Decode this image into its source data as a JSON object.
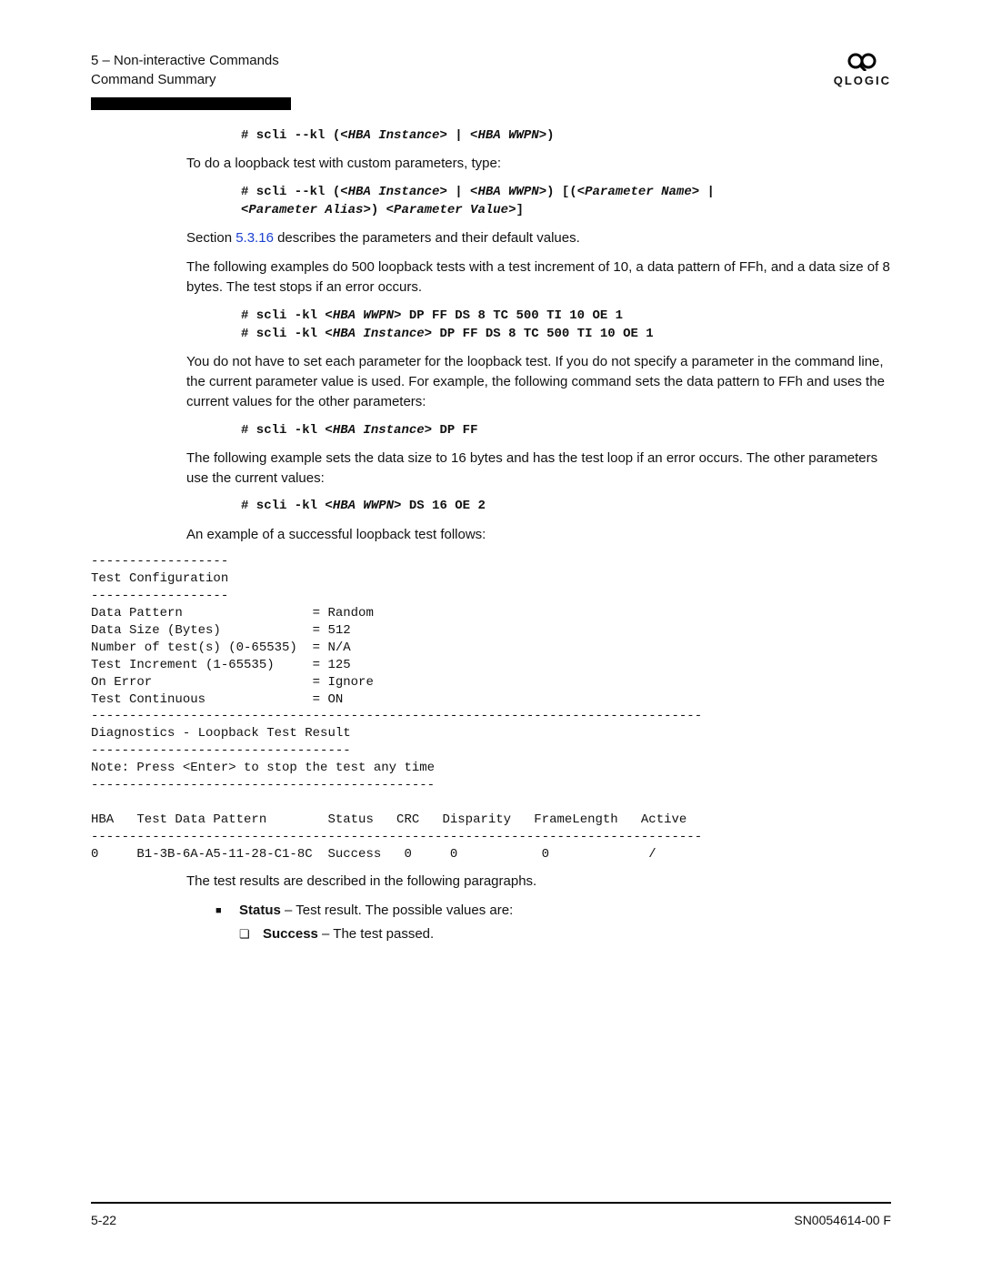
{
  "header": {
    "chapter": "5 – Non-interactive Commands",
    "section": "Command Summary",
    "brand": "QLOGIC"
  },
  "cmd1": {
    "pre": "# scli --kl (<",
    "v1": "HBA Instance",
    "mid": "> | <",
    "v2": "HBA WWPN",
    "post": ">)"
  },
  "p1": "To do a loopback test with custom parameters, type:",
  "cmd2": {
    "l1pre": "# scli --kl (<",
    "l1v1": "HBA Instance",
    "l1mid": "> | <",
    "l1v2": "HBA WWPN",
    "l1mid2": ">) [(<",
    "l1v3": "Parameter Name",
    "l1post": "> |",
    "l2pre": "<",
    "l2v1": "Parameter Alias",
    "l2mid": ">) <",
    "l2v2": "Parameter Value",
    "l2post": ">]"
  },
  "p2": {
    "a": "Section ",
    "link": "5.3.16",
    "b": " describes the parameters and their default values."
  },
  "p3": "The following examples do 500 loopback tests with a test increment of 10, a data pattern of FFh, and a data size of 8 bytes. The test stops if an error occurs.",
  "cmd3": {
    "l1pre": "# scli -kl <",
    "l1v": "HBA WWPN",
    "l1post": "> DP FF DS 8 TC 500 TI 10 OE 1",
    "l2pre": "# scli -kl <",
    "l2v": "HBA Instance",
    "l2post": "> DP FF DS 8 TC 500 TI 10 OE 1"
  },
  "p4": "You do not have to set each parameter for the loopback test. If you do not specify a parameter in the command line, the current parameter value is used. For example, the following command sets the data pattern to FFh and uses the current values for the other parameters:",
  "cmd4": {
    "pre": "# scli -kl <",
    "v": "HBA Instance",
    "post": "> DP FF"
  },
  "p5": "The following example sets the data size to 16 bytes and has the test loop if an error occurs. The other parameters use the current values:",
  "cmd5": {
    "pre": "# scli -kl <",
    "v": "HBA WWPN",
    "post": "> DS 16 OE 2"
  },
  "p6": "An example of a successful loopback test follows:",
  "output": "------------------\nTest Configuration\n------------------\nData Pattern                 = Random\nData Size (Bytes)            = 512\nNumber of test(s) (0-65535)  = N/A\nTest Increment (1-65535)     = 125\nOn Error                     = Ignore\nTest Continuous              = ON\n--------------------------------------------------------------------------------\nDiagnostics - Loopback Test Result\n----------------------------------\nNote: Press <Enter> to stop the test any time\n---------------------------------------------\n\nHBA   Test Data Pattern        Status   CRC   Disparity   FrameLength   Active\n--------------------------------------------------------------------------------\n0     B1-3B-6A-A5-11-28-C1-8C  Success   0     0           0             /",
  "p7": "The test results are described in the following paragraphs.",
  "bullet1": {
    "b": "Status",
    "t": " – Test result. The possible values are:"
  },
  "sub1": {
    "b": "Success",
    "t": " – The test passed."
  },
  "footer": {
    "left": "5-22",
    "right": "SN0054614-00  F"
  }
}
